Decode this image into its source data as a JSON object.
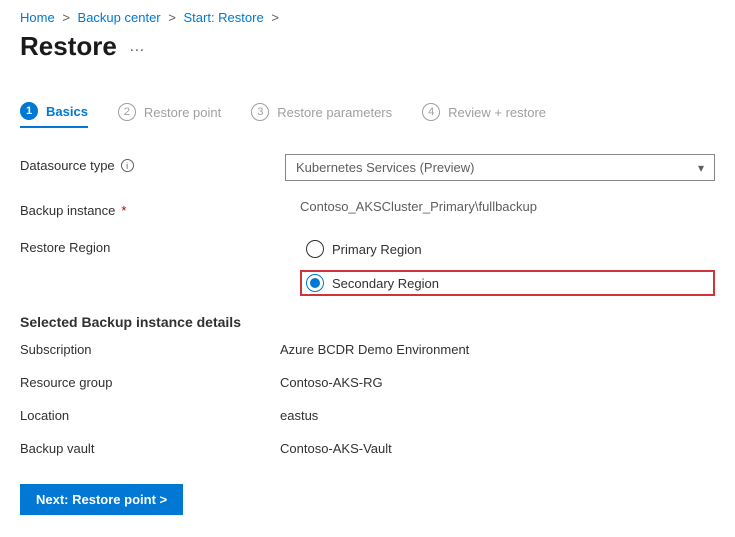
{
  "breadcrumb": [
    "Home",
    "Backup center",
    "Start: Restore"
  ],
  "page_title": "Restore",
  "tabs": [
    {
      "num": "1",
      "label": "Basics"
    },
    {
      "num": "2",
      "label": "Restore point"
    },
    {
      "num": "3",
      "label": "Restore parameters"
    },
    {
      "num": "4",
      "label": "Review + restore"
    }
  ],
  "labels": {
    "datasource_type": "Datasource type",
    "backup_instance": "Backup instance",
    "restore_region": "Restore Region"
  },
  "datasource_type_value": "Kubernetes Services (Preview)",
  "backup_instance_value": "Contoso_AKSCluster_Primary\\fullbackup",
  "restore_region_options": {
    "primary": "Primary Region",
    "secondary": "Secondary Region"
  },
  "selected_region": "secondary",
  "details_section_title": "Selected Backup instance details",
  "details": {
    "subscription_label": "Subscription",
    "subscription_value": "Azure BCDR Demo Environment",
    "resource_group_label": "Resource group",
    "resource_group_value": "Contoso-AKS-RG",
    "location_label": "Location",
    "location_value": "eastus",
    "backup_vault_label": "Backup vault",
    "backup_vault_value": "Contoso-AKS-Vault"
  },
  "next_button": "Next: Restore point  >"
}
